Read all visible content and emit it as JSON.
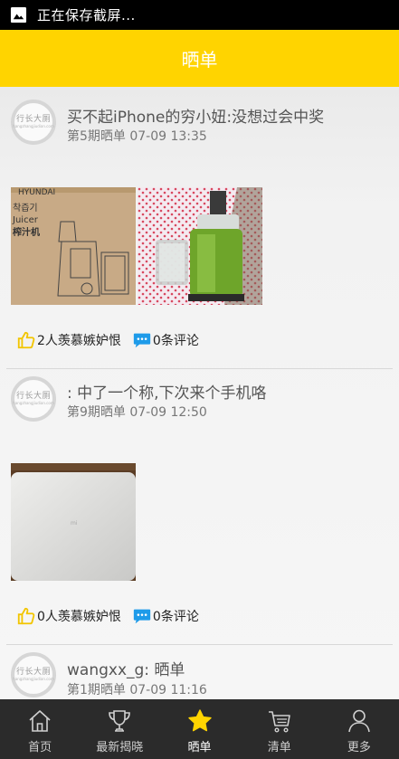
{
  "status_bar": {
    "text": "正在保存截屏..."
  },
  "app_bar": {
    "title": "晒单"
  },
  "avatar_logo": {
    "main": "行长大厕",
    "sub": "hangzhangjiudian.com"
  },
  "posts": [
    {
      "title": "买不起iPhone的穷小妞:没想过会中奖",
      "meta": "第5期晒单 07-09 13:35",
      "photo_texts": {
        "brand": "HYUNDAI",
        "kr": "착즙기",
        "en": "Juicer",
        "cn": "榨汁机"
      },
      "likes": "2人羡慕嫉妒恨",
      "comments": "0条评论"
    },
    {
      "title": ": 中了一个称,下次来个手机咯",
      "meta": "第9期晒单 07-09 12:50",
      "photo_texts": {
        "scale_logo": "mi"
      },
      "likes": "0人羡慕嫉妒恨",
      "comments": "0条评论"
    },
    {
      "title": "wangxx_g: 晒单",
      "meta": "第1期晒单 07-09 11:16"
    }
  ],
  "tabs": [
    {
      "label": "首页",
      "icon": "home-icon"
    },
    {
      "label": "最新揭晓",
      "icon": "trophy-icon"
    },
    {
      "label": "晒单",
      "icon": "star-icon",
      "active": true
    },
    {
      "label": "清单",
      "icon": "cart-icon"
    },
    {
      "label": "更多",
      "icon": "person-icon"
    }
  ],
  "colors": {
    "accent": "#ffd400",
    "tabbar": "#2b2b2b",
    "like_icon": "#f2c500",
    "comment_icon": "#1e9be9"
  }
}
